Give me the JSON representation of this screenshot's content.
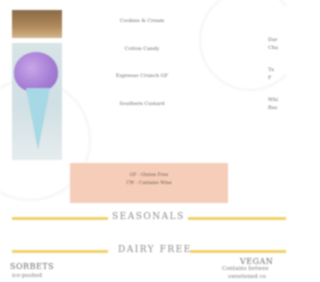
{
  "menu": {
    "items": [
      {
        "name": "Cookies & Cream",
        "desc": ""
      },
      {
        "name": "Cotton Candy",
        "desc": ""
      },
      {
        "name": "Espresso Crunch GF",
        "desc": ""
      },
      {
        "name": "Southern Custard",
        "desc": ""
      }
    ]
  },
  "side": {
    "line1": "Dar",
    "line2": "Cha",
    "line3": "Ta",
    "line4": "F",
    "line5": "Whi",
    "line6": "Bas"
  },
  "legend": {
    "gf": "GF - Gluten Free",
    "cw": "CW - Contains Wine"
  },
  "sections": {
    "seasonals": "SEASONALS",
    "dairy_free": "DAIRY FREE"
  },
  "bottom": {
    "sorbets": "SORBETS",
    "sorbets_sub": "ice-pushed",
    "vegan": "VEGAN",
    "vegan_sub1": "Contains betwee",
    "vegan_sub2": "sweetened co"
  },
  "colors": {
    "legend_bg": "#f6cdb9",
    "rule": "#f0d26a"
  }
}
